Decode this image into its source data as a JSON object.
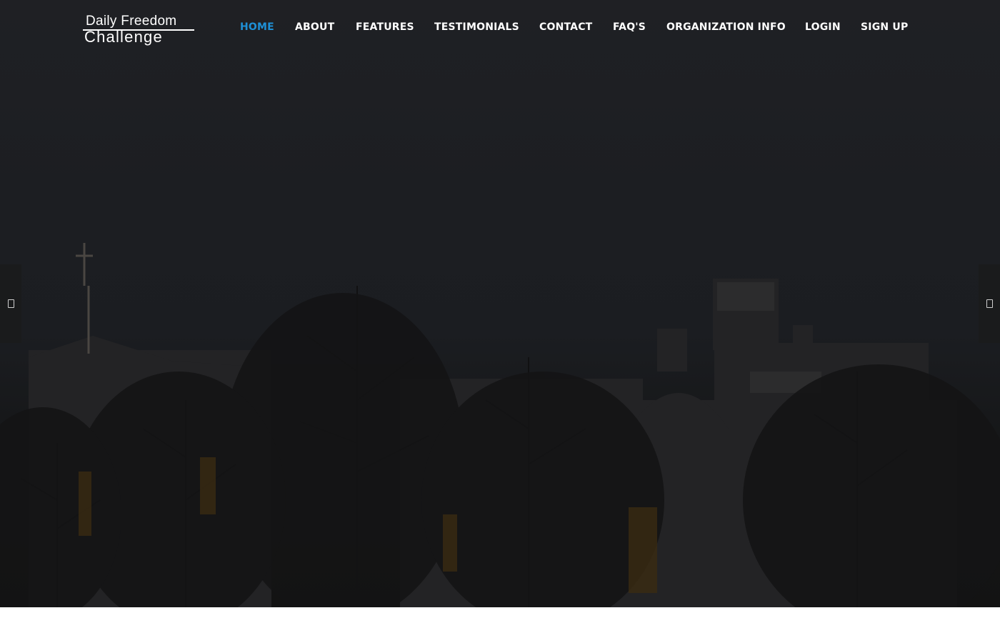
{
  "brand": {
    "line1": "Daily Freedom",
    "line2": "Challenge"
  },
  "nav": {
    "items": [
      {
        "label": "HOME",
        "active": true
      },
      {
        "label": "ABOUT",
        "active": false
      },
      {
        "label": "FEATURES",
        "active": false
      },
      {
        "label": "TESTIMONIALS",
        "active": false
      },
      {
        "label": "CONTACT",
        "active": false
      },
      {
        "label": "FAQ'S",
        "active": false
      },
      {
        "label": "ORGANIZATION INFO",
        "active": false
      },
      {
        "label": "LOGIN",
        "active": false
      },
      {
        "label": "SIGN UP",
        "active": false
      }
    ]
  },
  "slider": {
    "prev_icon": "square-outline-icon",
    "next_icon": "square-outline-icon"
  },
  "colors": {
    "accent": "#1e90d6",
    "nav_text": "#ffffff",
    "hero_overlay": "#1c1e22"
  }
}
